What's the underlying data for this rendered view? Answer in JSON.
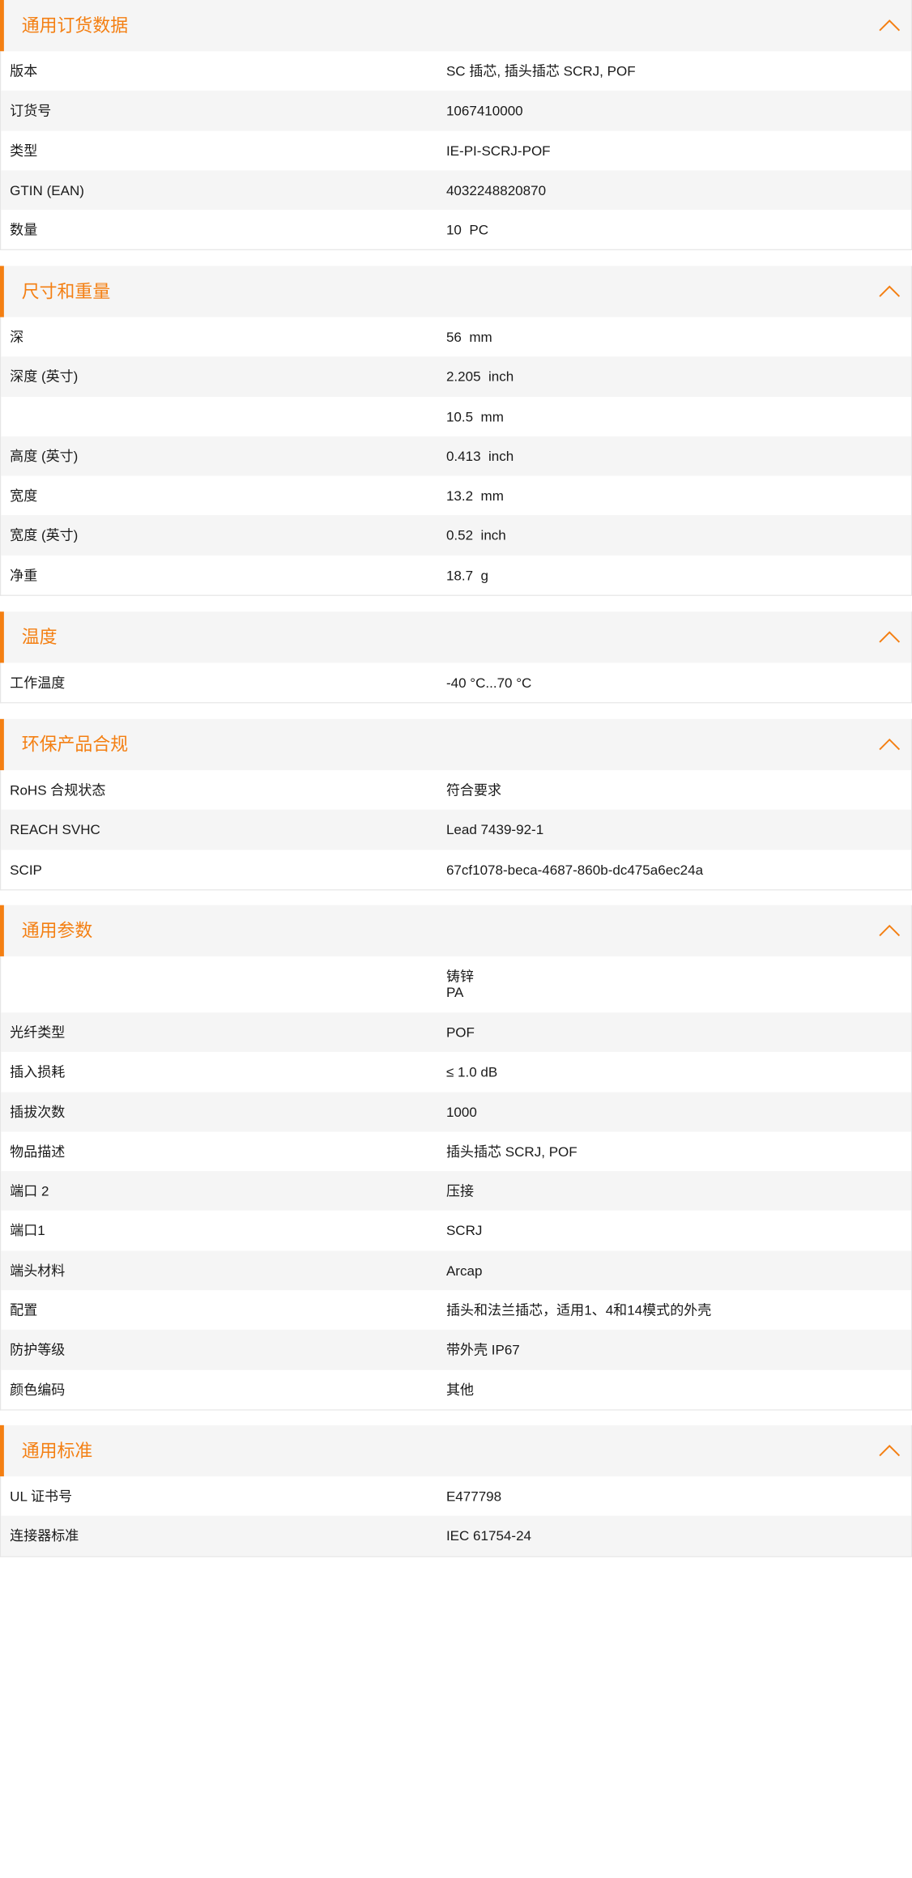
{
  "colors": {
    "accent": "#f47f12",
    "header_bg": "#f5f5f5",
    "row_alt_bg": "#f5f5f5",
    "border": "#e6e6e6",
    "text": "#1a1a1a"
  },
  "icons": {
    "collapse": "chevron-up-icon"
  },
  "sections": [
    {
      "title": "通用订货数据",
      "rows": [
        {
          "label": "版本",
          "value": "SC 插芯, 插头插芯 SCRJ, POF"
        },
        {
          "label": "订货号",
          "value": "1067410000"
        },
        {
          "label": "类型",
          "value": "IE-PI-SCRJ-POF"
        },
        {
          "label": "GTIN (EAN)",
          "value": "4032248820870"
        },
        {
          "label": "数量",
          "value": "10  PC"
        }
      ]
    },
    {
      "title": "尺寸和重量",
      "rows": [
        {
          "label": "深",
          "value": "56  mm"
        },
        {
          "label": "深度 (英寸)",
          "value": "2.205  inch"
        },
        {
          "label": "",
          "value": "10.5  mm"
        },
        {
          "label": "高度 (英寸)",
          "value": "0.413  inch"
        },
        {
          "label": "宽度",
          "value": "13.2  mm"
        },
        {
          "label": "宽度 (英寸)",
          "value": "0.52  inch"
        },
        {
          "label": "净重",
          "value": "18.7  g"
        }
      ]
    },
    {
      "title": "温度",
      "rows": [
        {
          "label": "工作温度",
          "value": "-40 °C...70 °C"
        }
      ]
    },
    {
      "title": "环保产品合规",
      "rows": [
        {
          "label": "RoHS 合规状态",
          "value": "符合要求"
        },
        {
          "label": "REACH SVHC",
          "value": "Lead 7439-92-1"
        },
        {
          "label": "SCIP",
          "value": "67cf1078-beca-4687-860b-dc475a6ec24a"
        }
      ]
    },
    {
      "title": "通用参数",
      "rows": [
        {
          "label": "",
          "value": "铸锌\nPA"
        },
        {
          "label": "光纤类型",
          "value": "POF"
        },
        {
          "label": "插入损耗",
          "value": "≤ 1.0 dB"
        },
        {
          "label": "插拔次数",
          "value": "1000"
        },
        {
          "label": "物品描述",
          "value": "插头插芯 SCRJ, POF"
        },
        {
          "label": "端口 2",
          "value": "压接"
        },
        {
          "label": "端口1",
          "value": "SCRJ"
        },
        {
          "label": "端头材料",
          "value": "Arcap"
        },
        {
          "label": "配置",
          "value": "插头和法兰插芯，适用1、4和14模式的外壳"
        },
        {
          "label": "防护等级",
          "value": "带外壳 IP67"
        },
        {
          "label": "颜色编码",
          "value": "其他"
        }
      ]
    },
    {
      "title": "通用标准",
      "rows": [
        {
          "label": "UL 证书号",
          "value": "E477798"
        },
        {
          "label": "连接器标准",
          "value": "IEC 61754-24"
        }
      ]
    }
  ]
}
